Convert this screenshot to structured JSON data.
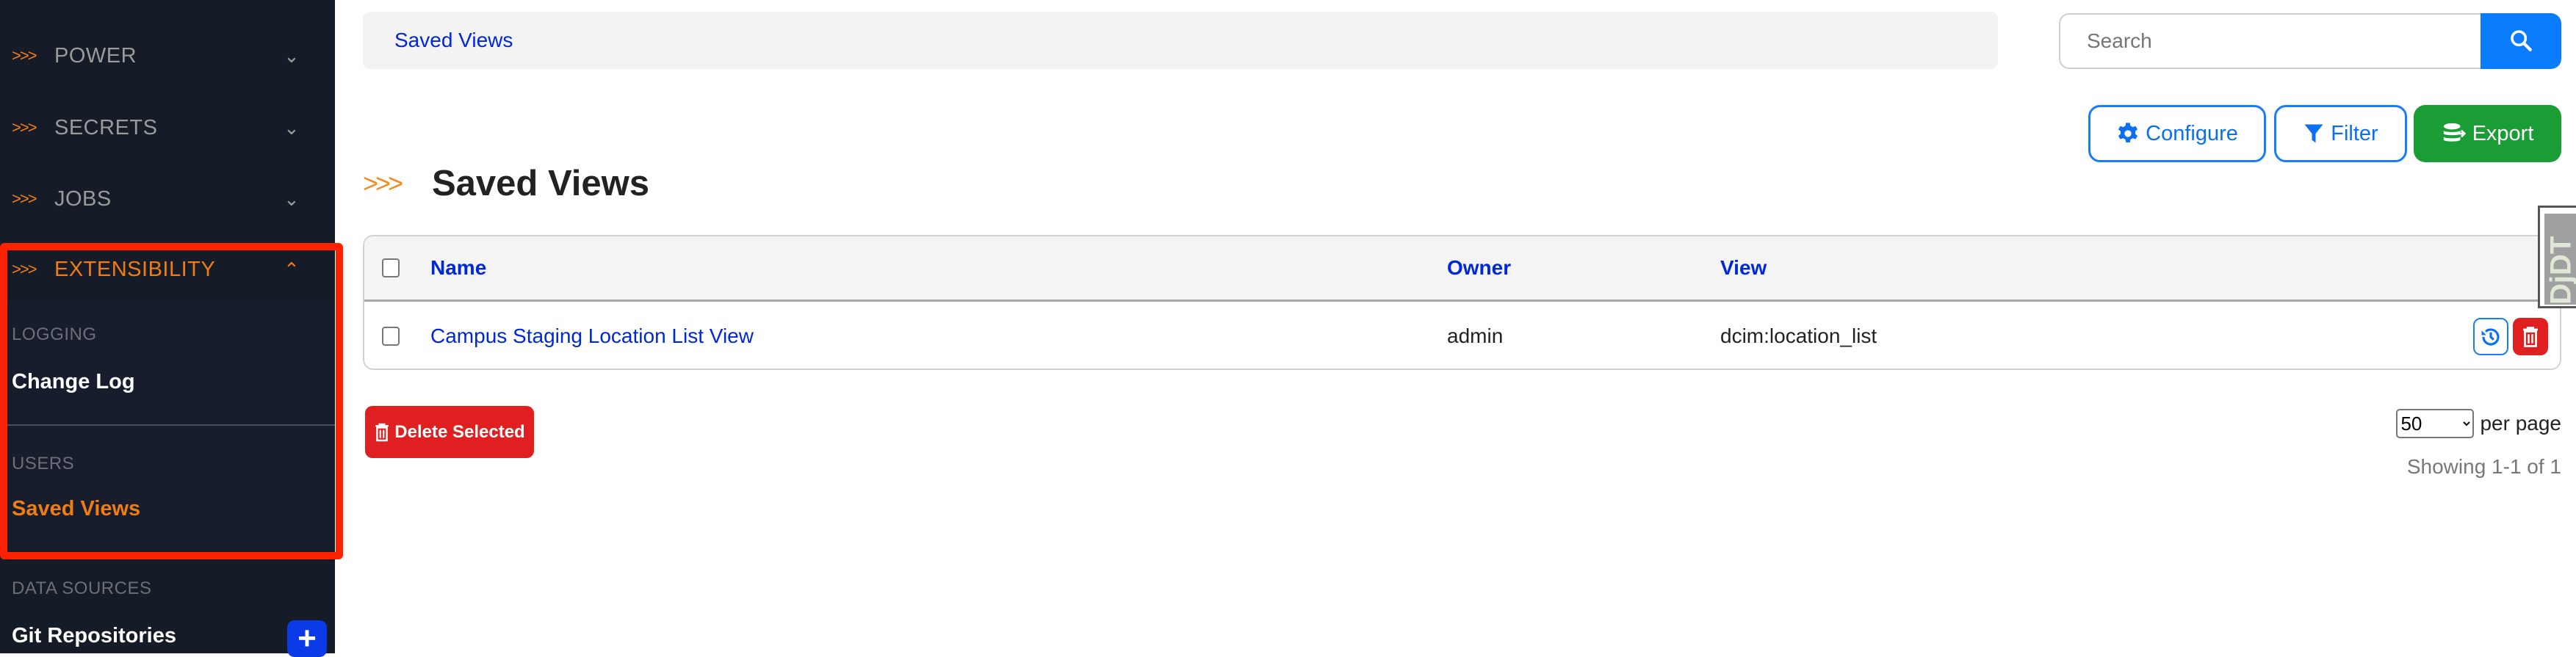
{
  "sidebar": {
    "sections": [
      {
        "label": "POWER",
        "arrow": ">>>",
        "expanded": false
      },
      {
        "label": "SECRETS",
        "arrow": ">>>",
        "expanded": false
      },
      {
        "label": "JOBS",
        "arrow": ">>>",
        "expanded": false
      },
      {
        "label": "EXTENSIBILITY",
        "arrow": ">>>",
        "expanded": true
      }
    ],
    "groups": {
      "logging": "LOGGING",
      "users": "USERS",
      "data_sources": "DATA SOURCES"
    },
    "links": {
      "change_log": "Change Log",
      "saved_views": "Saved Views",
      "git_repositories": "Git Repositories"
    },
    "add_icon": "plus-icon"
  },
  "breadcrumb": {
    "current": "Saved Views"
  },
  "search": {
    "placeholder": "Search",
    "value": ""
  },
  "toolbar": {
    "configure": "Configure",
    "filter": "Filter",
    "export": "Export"
  },
  "page": {
    "title_arrow": ">>>",
    "title": "Saved Views"
  },
  "table": {
    "headers": {
      "name": "Name",
      "owner": "Owner",
      "view": "View"
    },
    "rows": [
      {
        "name": "Campus Staging Location List View",
        "owner": "admin",
        "view": "dcim:location_list"
      }
    ]
  },
  "actions": {
    "delete_selected": "Delete Selected"
  },
  "pagination": {
    "per_page_value": "50",
    "per_page_label": "per page",
    "showing": "Showing 1-1 of 1"
  },
  "debug_toolbar": {
    "handle_label": "DjDT"
  },
  "colors": {
    "sidebar_bg": "#161b28",
    "accent_orange": "#f07d14",
    "primary": "#0a7cfe",
    "success": "#1b9d35",
    "danger": "#e02020",
    "highlight_box": "#ff2200"
  }
}
